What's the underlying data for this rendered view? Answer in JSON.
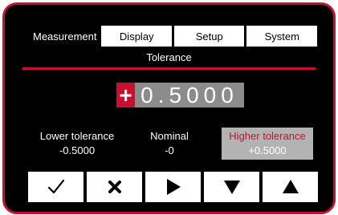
{
  "tabs": [
    {
      "label": "Measurement",
      "active": true
    },
    {
      "label": "Display",
      "active": false
    },
    {
      "label": "Setup",
      "active": false
    },
    {
      "label": "System",
      "active": false
    }
  ],
  "screen": {
    "title": "Tolerance",
    "value_sign": "+",
    "value_digits": "0.5000"
  },
  "fields": {
    "lower": {
      "label": "Lower tolerance",
      "value": "-0.5000"
    },
    "nominal": {
      "label": "Nominal",
      "value": "-0"
    },
    "higher": {
      "label": "Higher tolerance",
      "value": "+0.5000",
      "selected": true
    }
  },
  "buttons": [
    {
      "icon": "check-icon"
    },
    {
      "icon": "cross-icon"
    },
    {
      "icon": "play-right-icon"
    },
    {
      "icon": "arrow-down-icon"
    },
    {
      "icon": "arrow-up-icon"
    }
  ],
  "colors": {
    "accent": "#c8102e",
    "background": "#000000",
    "value_box": "#8c8c8c",
    "selected_field": "#b3b3b3"
  }
}
